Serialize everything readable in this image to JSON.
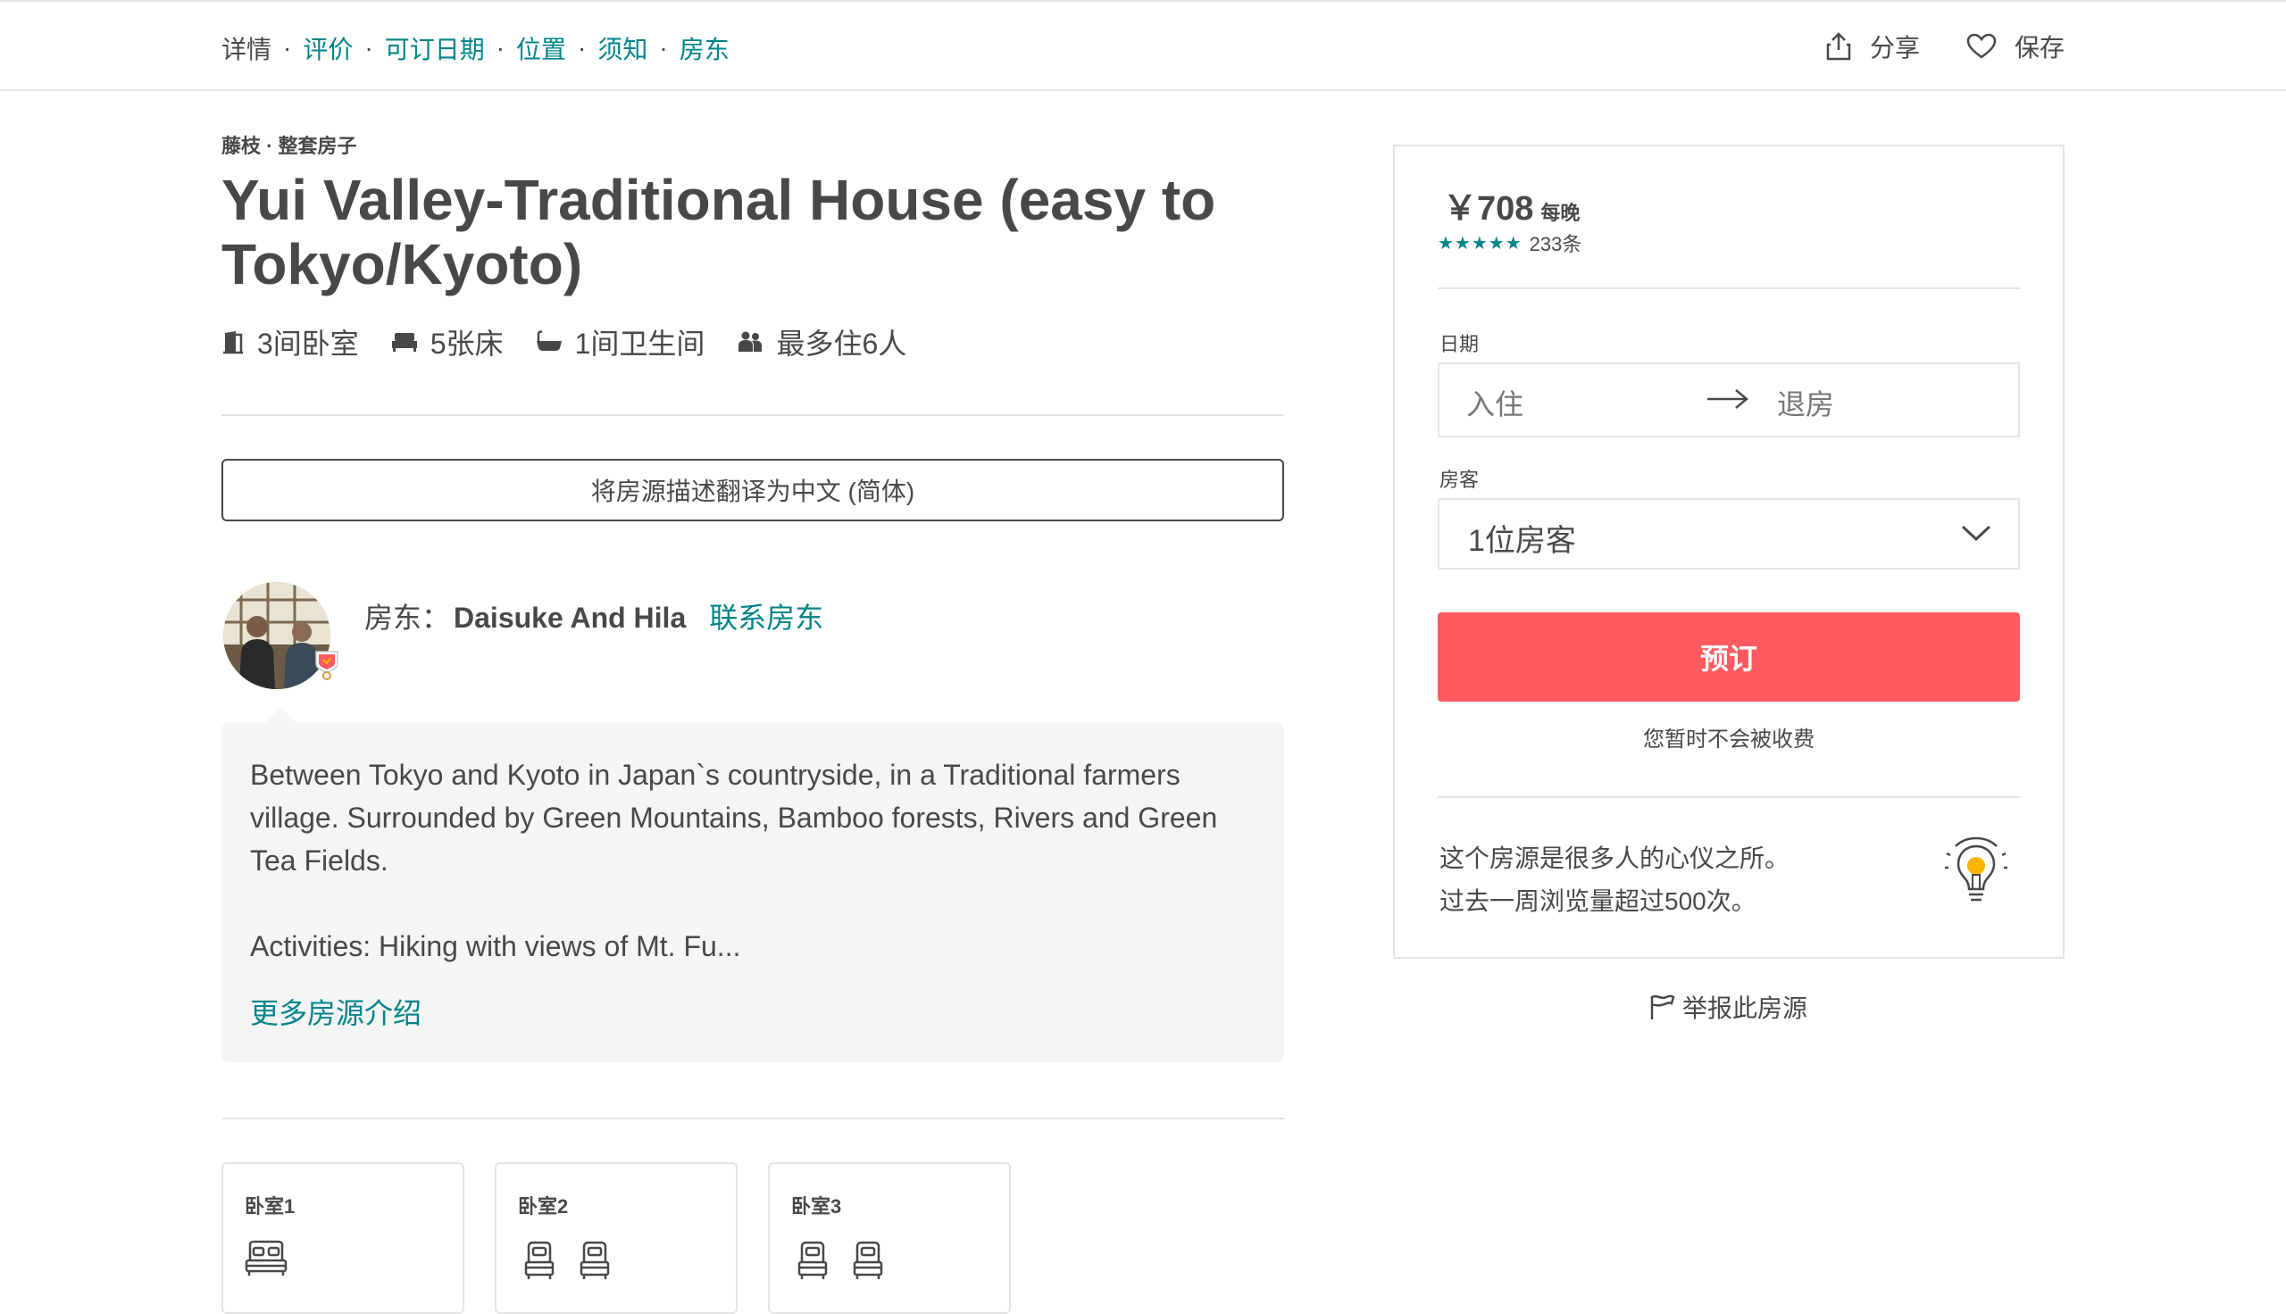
{
  "nav": {
    "current": "详情",
    "links": [
      "评价",
      "可订日期",
      "位置",
      "须知",
      "房东"
    ],
    "separator": "·",
    "share_label": "分享",
    "save_label": "保存"
  },
  "listing": {
    "subtitle": "藤枝 · 整套房子",
    "title": "Yui Valley-Traditional House (easy to Tokyo/Kyoto)",
    "amenities": {
      "bedrooms": "3间卧室",
      "beds": "5张床",
      "baths": "1间卫生间",
      "guests": "最多住6人"
    },
    "translate_label": "将房源描述翻译为中文 (简体)",
    "host": {
      "label": "房东：",
      "name": "Daisuke And Hila",
      "contact_label": "联系房东"
    },
    "description": "Between Tokyo and Kyoto in Japan`s countryside, in a Traditional farmers village. Surrounded by Green Mountains, Bamboo forests, Rivers and Green Tea Fields.\n\nActivities: Hiking with views of Mt. Fu...",
    "more_label": "更多房源介绍",
    "rooms": [
      {
        "label": "卧室1"
      },
      {
        "label": "卧室2"
      },
      {
        "label": "卧室3"
      }
    ]
  },
  "booking": {
    "price": "￥708",
    "per_night": "每晚",
    "stars": "★★★★★",
    "reviews": "233条",
    "dates_label": "日期",
    "checkin_placeholder": "入住",
    "checkout_placeholder": "退房",
    "guests_label": "房客",
    "guests_value": "1位房客",
    "book_label": "预订",
    "no_charge": "您暂时不会被收费",
    "popular_line1": "这个房源是很多人的心仪之所。",
    "popular_line2": "过去一周浏览量超过500次。"
  },
  "report_label": "举报此房源",
  "colors": {
    "accent": "#008489",
    "book_button": "#ff5a5f",
    "text": "#484848",
    "border": "#e4e4e4"
  }
}
